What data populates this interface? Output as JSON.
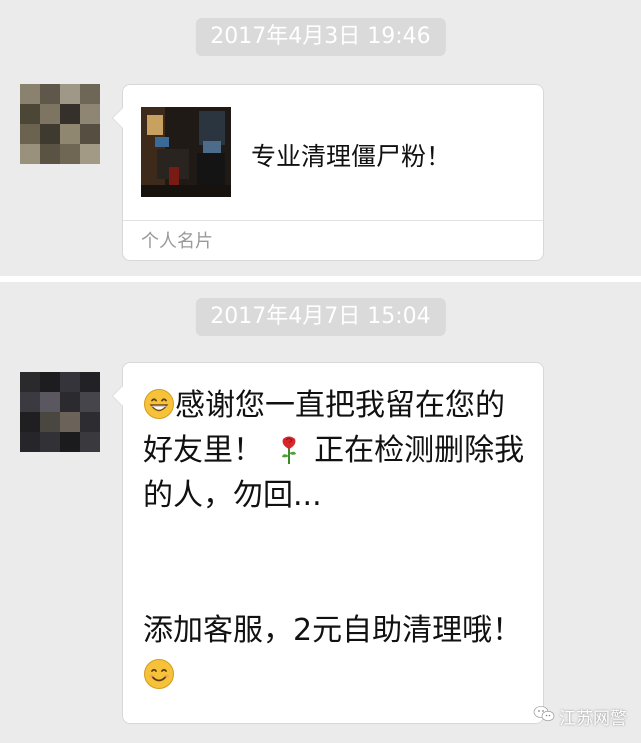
{
  "chat": {
    "message_1": {
      "timestamp": "2017年4月3日 19:46",
      "card": {
        "name": "专业清理僵尸粉！",
        "footer": "个人名片"
      }
    },
    "message_2": {
      "timestamp": "2017年4月7日 15:04",
      "lines": [
        "感谢您一直把我留在您的",
        "好友里！",
        "正在检测删除我",
        "的人，勿回...",
        "添加客服，2元自助清理哦！"
      ],
      "emojis": [
        "grinning-face",
        "rose",
        "smiling-face"
      ]
    }
  },
  "watermark": {
    "text": "江苏网警"
  },
  "colors": {
    "chat_background": "#ebebeb",
    "timestamp_background": "#dadada",
    "bubble_background": "#ffffff",
    "bubble_border": "#d8d8d8",
    "emoji_yellow": "#f5c23a"
  }
}
